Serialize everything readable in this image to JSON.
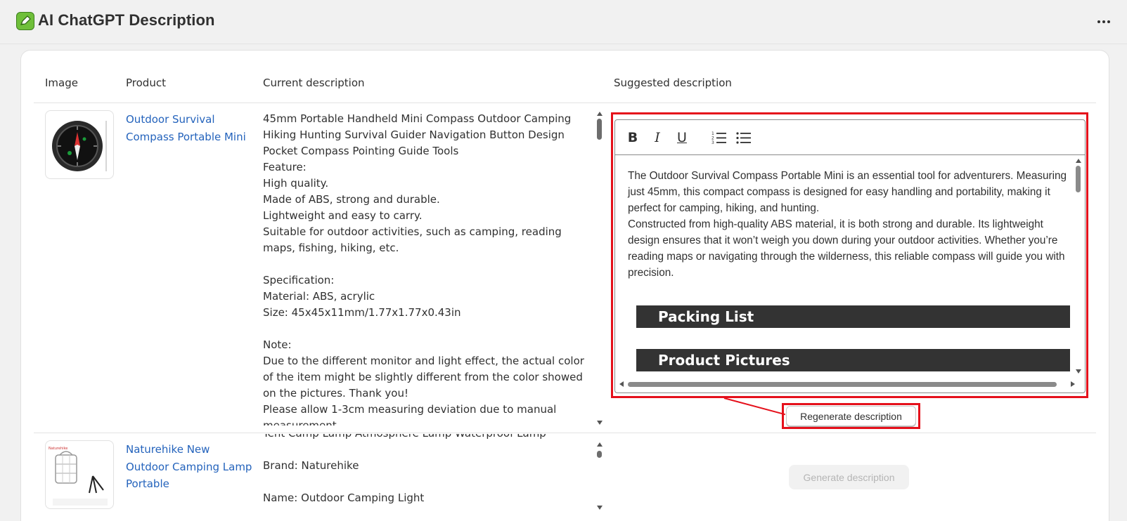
{
  "app": {
    "title": "AI ChatGPT Description",
    "icon": "app-logo-icon",
    "more_icon": "more-horizontal-icon"
  },
  "table": {
    "headers": [
      "Image",
      "Product",
      "Current description",
      "Suggested description"
    ],
    "rows": [
      {
        "product": "Outdoor Survival Compass Portable Mini",
        "product_lines": [
          "Outdoor Survival",
          "Compass Portable Mini"
        ],
        "current_description": "45mm Portable Handheld Mini Compass Outdoor Camping Hiking Hunting Survival Guider Navigation Button Design Pocket Compass Pointing Guide Tools\nFeature:\nHigh quality.\nMade of ABS, strong and durable.\nLightweight and easy to carry.\nSuitable for outdoor activities, such as camping, reading maps, fishing, hiking, etc.\n\nSpecification:\nMaterial: ABS, acrylic\nSize: 45x45x11mm/1.77x1.77x0.43in\n\nNote:\nDue to the different monitor and light effect, the actual color of the item might be slightly different from the color showed on the pictures. Thank you!\nPlease allow 1-3cm measuring deviation due to manual measurement.",
        "suggested": {
          "paragraph_1": "The Outdoor Survival Compass Portable Mini is an essential tool for adventurers. Measuring just 45mm, this compact compass is designed for easy handling and portability, making it perfect for camping, hiking, and hunting.",
          "paragraph_2": "Constructed from high-quality ABS material, it is both strong and durable. Its lightweight design ensures that it won’t weigh you down during your outdoor activities. Whether you’re reading maps or navigating through the wilderness, this reliable compass will guide you with precision.",
          "band_1": "Packing List",
          "band_2": "Product Pictures"
        },
        "action": "Regenerate description"
      },
      {
        "product": "Naturehike New Outdoor Camping Lamp Portable",
        "product_lines": [
          "Naturehike New",
          "Outdoor Camping Lamp",
          "Portable"
        ],
        "current_description": "Tent Camp Lamp Atmosphere Lamp Waterproof Lamp\n\nBrand: Naturehike\n\nName: Outdoor Camping Light",
        "action": "Generate description"
      }
    ]
  },
  "toolbar": {
    "bold": "B",
    "italic": "I",
    "underline": "U",
    "ordered_list_icon": "ordered-list-icon",
    "bullet_list_icon": "bullet-list-icon"
  },
  "colors": {
    "link": "#2463bc",
    "highlight": "#e5101b",
    "band": "#333333"
  }
}
